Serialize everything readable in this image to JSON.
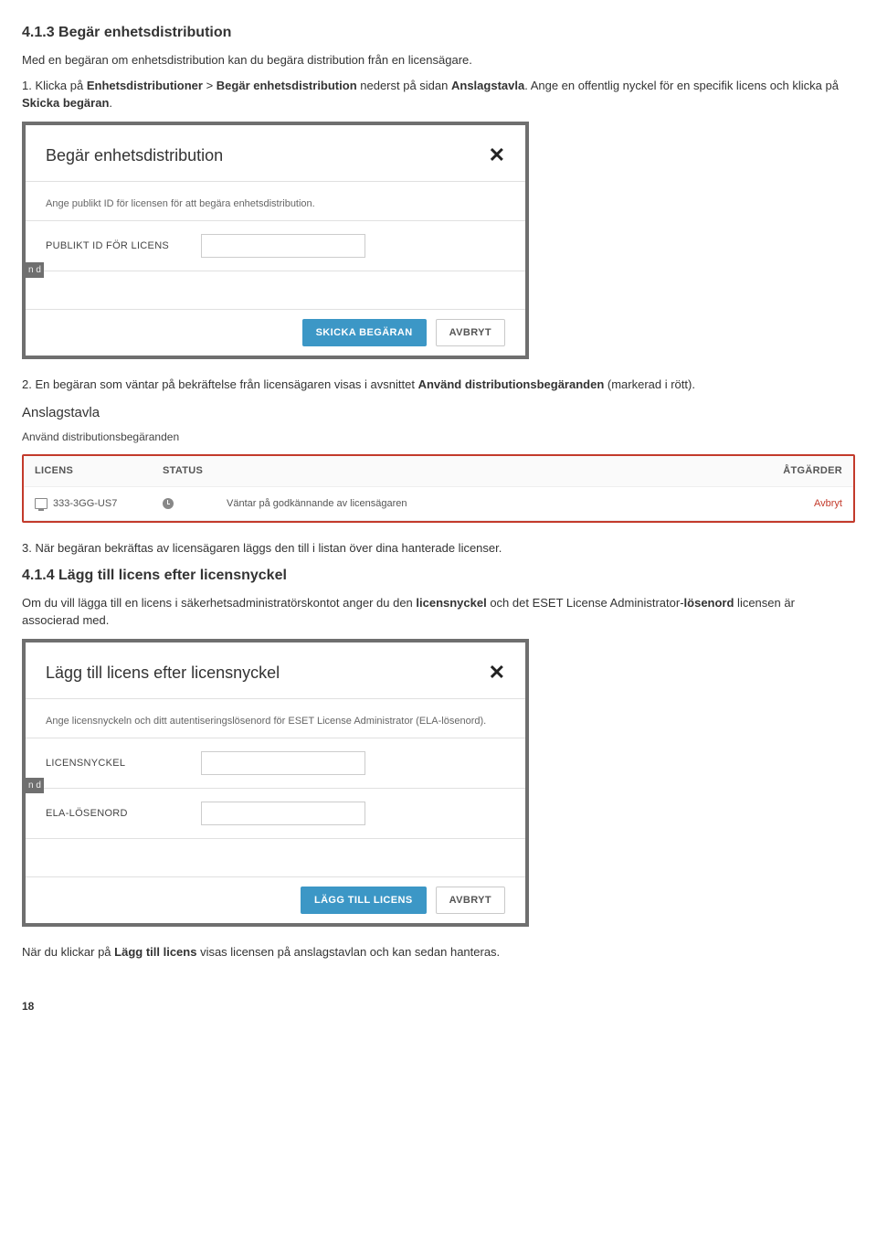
{
  "section413": {
    "heading": "4.1.3   Begär enhetsdistribution",
    "intro": "Med en begäran om enhetsdistribution kan du begära distribution från en licensägare.",
    "step1_prefix": "1.  Klicka på ",
    "step1_bold1": "Enhetsdistributioner",
    "step1_mid1": " > ",
    "step1_bold2": "Begär enhetsdistribution",
    "step1_mid2": " nederst på sidan ",
    "step1_bold3": "Anslagstavla",
    "step1_mid3": ". Ange en offentlig nyckel för en specifik licens och klicka på ",
    "step1_bold4": "Skicka begäran",
    "step1_end": "."
  },
  "modal1": {
    "title": "Begär enhetsdistribution",
    "desc": "Ange publikt ID för licensen för att begära enhetsdistribution.",
    "field_label": "PUBLIKT ID FÖR LICENS",
    "btn_primary": "SKICKA BEGÄRAN",
    "btn_cancel": "AVBRYT"
  },
  "step2": {
    "prefix": "2.  En begäran som väntar på bekräftelse från licensägaren visas i avsnittet ",
    "bold": "Använd distributionsbegäranden",
    "suffix": " (markerad i rött)."
  },
  "anslag": {
    "title": "Anslagstavla",
    "sub": "Använd distributionsbegäranden",
    "th_licens": "LICENS",
    "th_status": "STATUS",
    "th_act": "ÅTGÄRDER",
    "row_licens": "333-3GG-US7",
    "row_msg": "Väntar på godkännande av licensägaren",
    "row_act": "Avbryt"
  },
  "step3": "3.  När begäran bekräftas av licensägaren läggs den till i listan över dina hanterade licenser.",
  "section414": {
    "heading": "4.1.4   Lägg till licens efter licensnyckel",
    "intro_prefix": "Om du vill lägga till en licens i säkerhetsadministratörskontot anger du den ",
    "intro_bold1": "licensnyckel",
    "intro_mid": " och det ESET License Administrator-",
    "intro_bold2": "lösenord",
    "intro_suffix": " licensen är associerad med."
  },
  "modal2": {
    "title": "Lägg till licens efter licensnyckel",
    "desc": "Ange licensnyckeln och ditt autentiseringslösenord för ESET License Administrator (ELA-lösenord).",
    "field1": "LICENSNYCKEL",
    "field2": "ELA-LÖSENORD",
    "btn_primary": "LÄGG TILL LICENS",
    "btn_cancel": "AVBRYT"
  },
  "closing": {
    "prefix": "När du klickar på ",
    "bold": "Lägg till licens",
    "suffix": " visas licensen på anslagstavlan och kan sedan hanteras."
  },
  "page_number": "18"
}
